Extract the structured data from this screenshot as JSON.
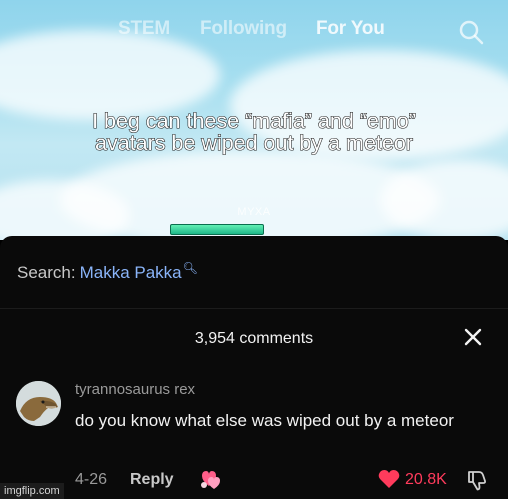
{
  "header": {
    "tabs": [
      {
        "label": "STEM",
        "active": false
      },
      {
        "label": "Following",
        "active": false
      },
      {
        "label": "For You",
        "active": true
      }
    ],
    "search_icon": "search-icon"
  },
  "video": {
    "caption_lines": [
      "I beg can these “mafia” and “emo”",
      "avatars be wiped out by a meteor"
    ],
    "nametag": "MYXA"
  },
  "search": {
    "prefix": "Search:",
    "term": "Makka Pakka",
    "icon": "search-icon"
  },
  "comments": {
    "count_label": "3,954 comments",
    "close_icon": "close-icon",
    "items": [
      {
        "username": "tyrannosaurus rex",
        "text": "do you know what else was wiped out by a meteor",
        "date": "4-26",
        "reply_label": "Reply",
        "likes": "20.8K",
        "liked": true
      }
    ]
  },
  "watermark": "imgflip.com",
  "colors": {
    "accent_link": "#8ab4f8",
    "like_red": "#ff3b5c",
    "sheet_bg": "#0a0a0a"
  }
}
